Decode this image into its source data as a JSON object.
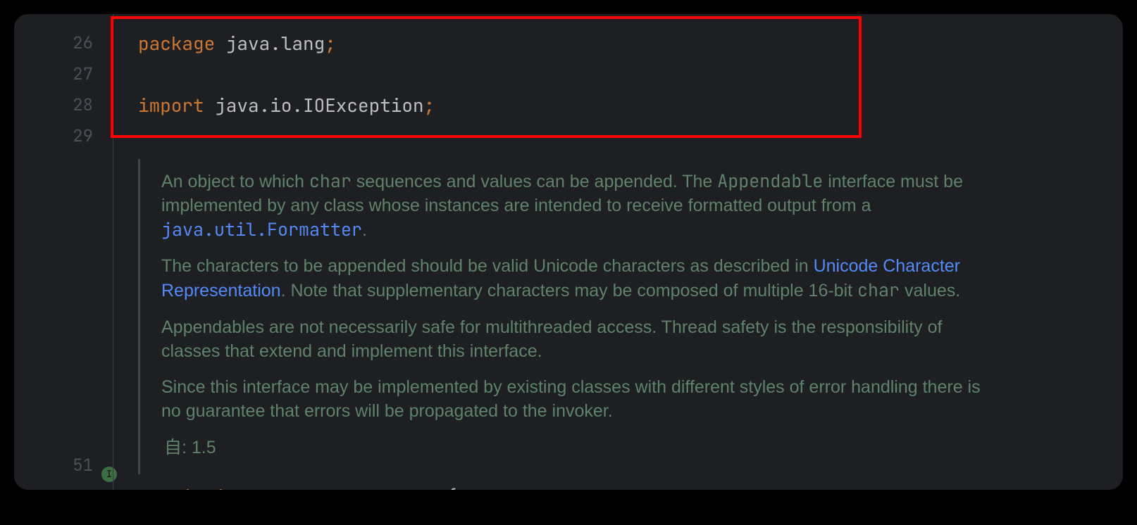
{
  "gutter": {
    "lines": [
      "26",
      "27",
      "28",
      "29"
    ],
    "lastLine": "51",
    "implementsIconLetter": "I",
    "downArrow": "↓"
  },
  "code": {
    "line26": {
      "kwPackage": "package ",
      "pkgName": "java.lang",
      "semi": ";"
    },
    "line28": {
      "kwImport": "import ",
      "pkgName": "java.io.IOException",
      "semi": ";"
    },
    "declaration": {
      "kwPublic": "public ",
      "kwInterface": "interface ",
      "className": "Appendable ",
      "brace": "{"
    }
  },
  "javadoc": {
    "p1_a": "An object to which ",
    "p1_char": "char",
    "p1_b": " sequences and values can be appended. The ",
    "p1_appendable": "Appendable",
    "p1_c": " interface must be implemented by any class whose instances are intended to receive formatted output from a ",
    "p1_link": "java.util.Formatter",
    "p1_d": ".",
    "p2_a": "The characters to be appended should be valid Unicode characters as described in ",
    "p2_link": "Unicode Character Representation",
    "p2_b": ". Note that supplementary characters may be composed of multiple 16-bit ",
    "p2_char": "char",
    "p2_c": " values.",
    "p3": "Appendables are not necessarily safe for multithreaded access. Thread safety is the responsibility of classes that extend and implement this interface.",
    "p4": "Since this interface may be implemented by existing classes with different styles of error handling there is no guarantee that errors will be propagated to the invoker.",
    "since": "自: 1.5"
  }
}
